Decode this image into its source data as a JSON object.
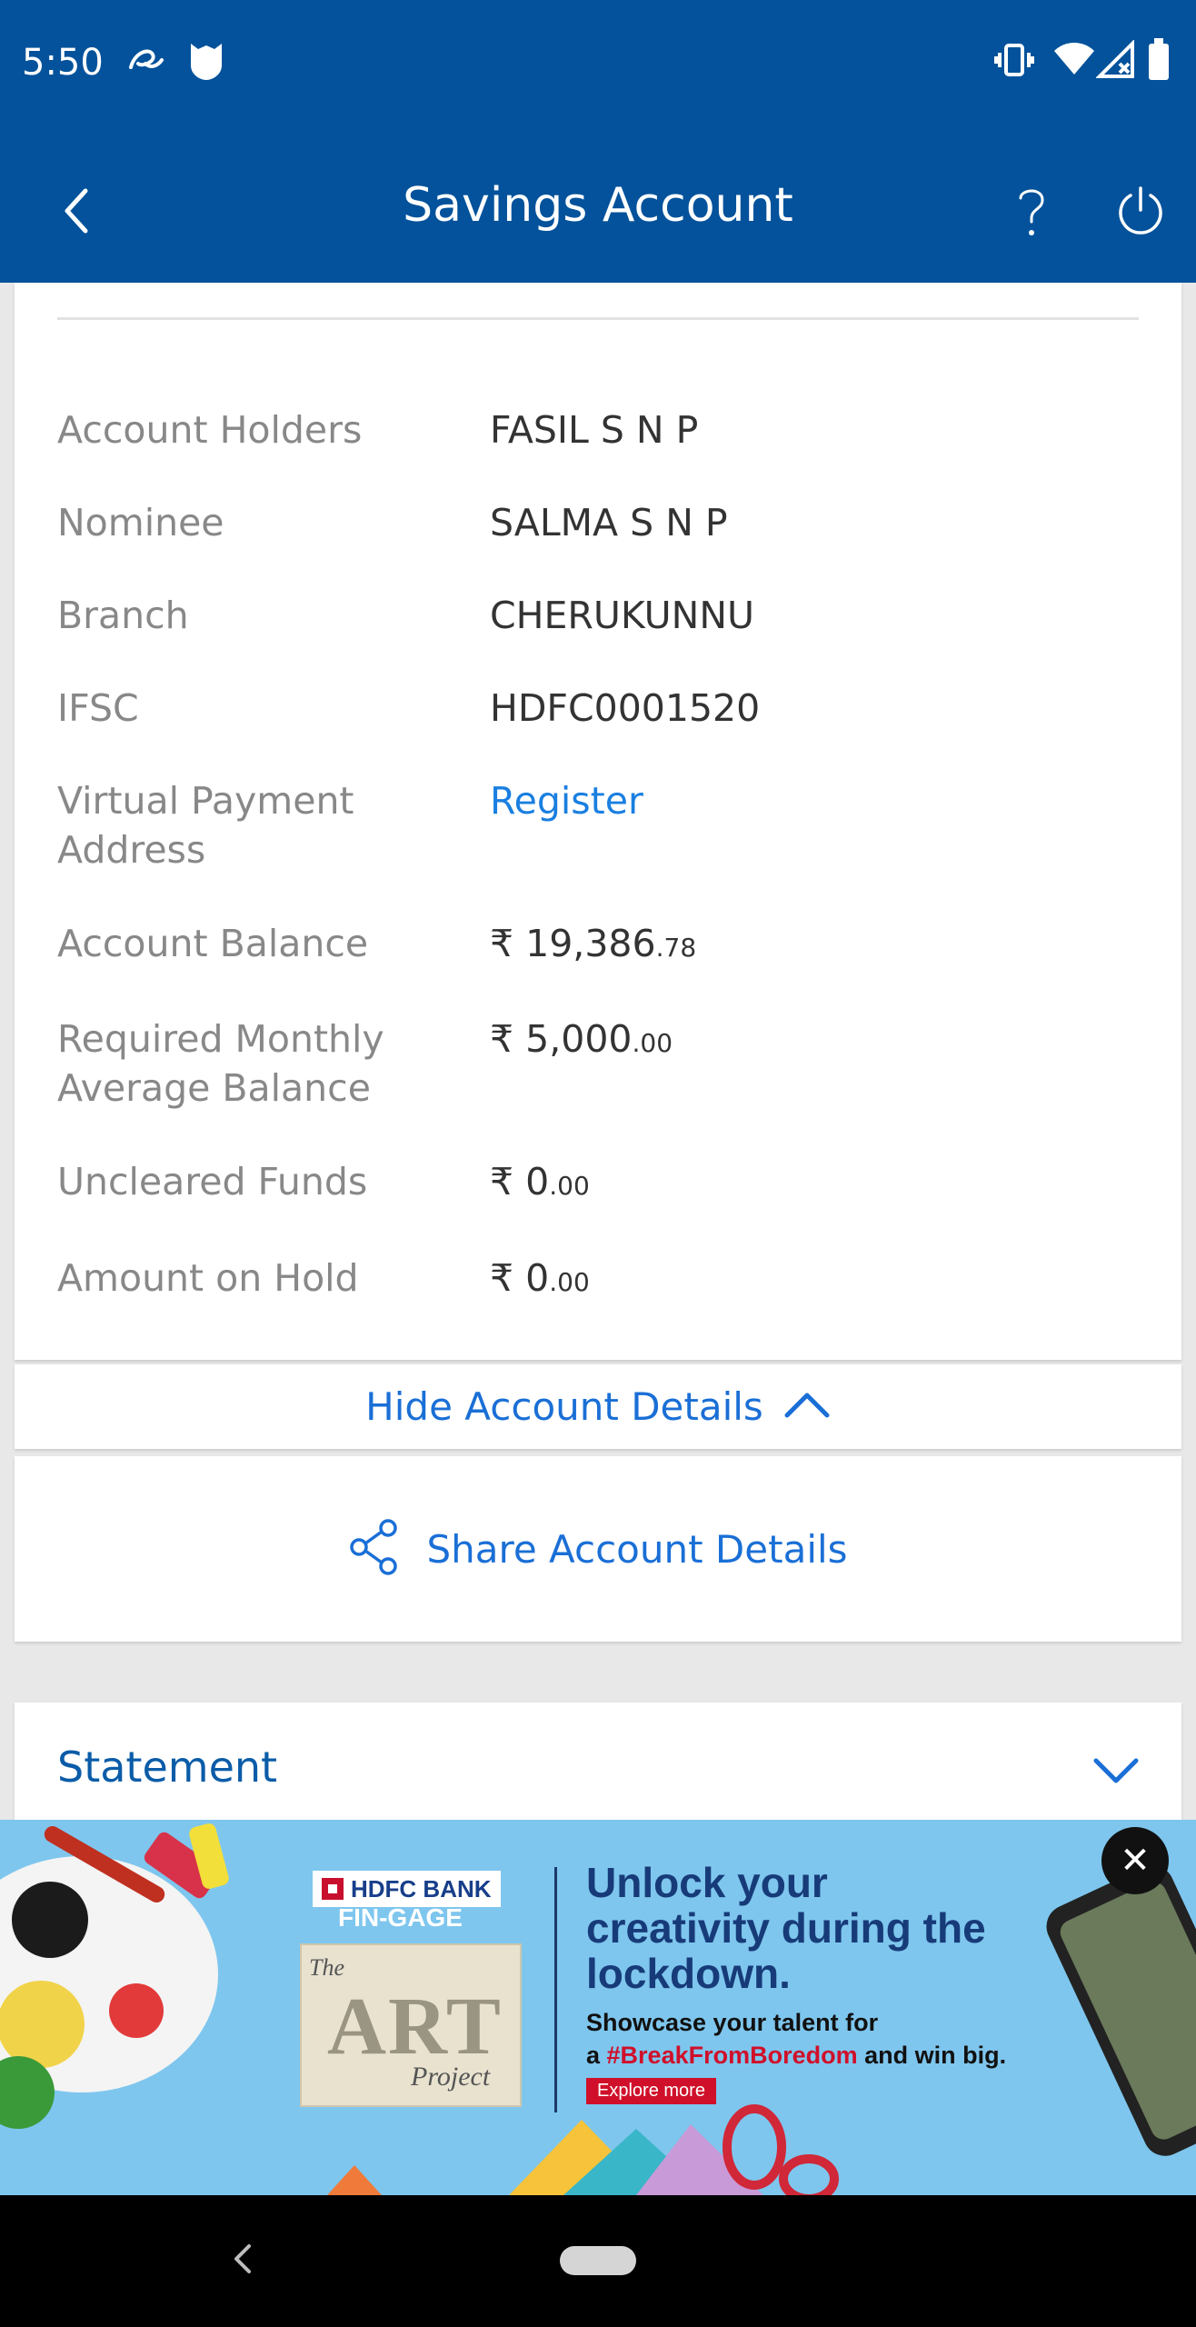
{
  "status_bar": {
    "time": "5:50",
    "left_icons": [
      "notification-icon",
      "shield-icon"
    ],
    "right_icons": [
      "vibrate-icon",
      "wifi-icon",
      "signal-icon",
      "battery-icon"
    ]
  },
  "app_bar": {
    "title": "Savings Account",
    "icons": [
      "back-arrow-icon",
      "help-icon",
      "power-icon"
    ]
  },
  "account_details": [
    {
      "label": "Account Holders",
      "value": "FASIL S N P"
    },
    {
      "label": "Nominee",
      "value": "SALMA S N P"
    },
    {
      "label": "Branch",
      "value": "CHERUKUNNU"
    },
    {
      "label": "IFSC",
      "value": "HDFC0001520"
    },
    {
      "label": "Virtual Payment Address",
      "value": "Register",
      "link": true
    },
    {
      "label": "Account Balance",
      "currency": "₹",
      "whole": "19,386",
      "decimal": ".78"
    },
    {
      "label": "Required Monthly Average Balance",
      "currency": "₹",
      "whole": "5,000",
      "decimal": ".00"
    },
    {
      "label": "Uncleared Funds",
      "currency": "₹",
      "whole": "0",
      "decimal": ".00"
    },
    {
      "label": "Amount on Hold",
      "currency": "₹",
      "whole": "0",
      "decimal": ".00"
    }
  ],
  "hide_details_label": "Hide Account Details",
  "share_label": "Share Account Details",
  "statement_label": "Statement",
  "banner": {
    "brand": "HDFC BANK",
    "program": "FIN-GAGE",
    "art_the": "The",
    "art_word": "ART",
    "art_project": "Project",
    "headline": "Unlock your creativity during the lockdown.",
    "subtext_1": "Showcase your talent for",
    "subtext_2_prefix": "a ",
    "hashtag": "#BreakFromBoredom",
    "subtext_2_suffix": " and win big.",
    "cta": "Explore more",
    "close_symbol": "✕"
  },
  "colors": {
    "header": "#03529b",
    "link": "#1a7fe0",
    "accent": "#1a6fd6",
    "banner_bg": "#7ec6ee"
  }
}
